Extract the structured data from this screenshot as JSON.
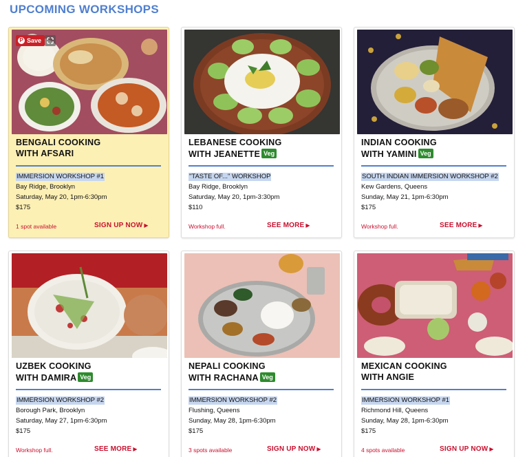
{
  "page": {
    "title": "UPCOMING WORKSHOPS"
  },
  "pin": {
    "save_label": "Save",
    "p_glyph": "P"
  },
  "cards": [
    {
      "name_line1": "BENGALI COOKING",
      "name_line2": "WITH AFSARI",
      "veg": "",
      "workshop_type": "IMMERSION WORKSHOP #1",
      "location": "Bay Ridge, Brooklyn",
      "date": "Saturday, May 20, 1pm-6:30pm",
      "price": "$175",
      "availability": "1 spot available",
      "action": "SIGN UP NOW"
    },
    {
      "name_line1": "LEBANESE COOKING",
      "name_line2": "WITH JEANETTE",
      "veg": "Veg",
      "workshop_type": "\"TASTE OF...\" WORKSHOP",
      "location": "Bay Ridge, Brooklyn",
      "date": "Saturday, May 20, 1pm-3:30pm",
      "price": "$110",
      "availability": "Workshop full.",
      "action": "SEE MORE"
    },
    {
      "name_line1": "INDIAN COOKING",
      "name_line2": "WITH YAMINI",
      "veg": "Veg",
      "workshop_type": "SOUTH INDIAN IMMERSION WORKSHOP #2",
      "location": "Kew Gardens, Queens",
      "date": "Sunday, May 21, 1pm-6:30pm",
      "price": "$175",
      "availability": "Workshop full.",
      "action": "SEE MORE"
    },
    {
      "name_line1": "UZBEK COOKING",
      "name_line2": "WITH DAMIRA",
      "veg": "Veg",
      "workshop_type": "IMMERSION WORKSHOP #2",
      "location": "Borough Park, Brooklyn",
      "date": "Saturday, May 27, 1pm-6:30pm",
      "price": "$175",
      "availability": "Workshop full.",
      "action": "SEE MORE"
    },
    {
      "name_line1": "NEPALI COOKING",
      "name_line2": "WITH RACHANA",
      "veg": "Veg",
      "workshop_type": "IMMERSION WORKSHOP #2",
      "location": "Flushing, Queens",
      "date": "Sunday, May 28, 1pm-6:30pm",
      "price": "$175",
      "availability": "3 spots available",
      "action": "SIGN UP NOW"
    },
    {
      "name_line1": "MEXICAN COOKING",
      "name_line2": "WITH ANGIE",
      "veg": "",
      "workshop_type": "IMMERSION WORKSHOP #1",
      "location": "Richmond Hill, Queens",
      "date": "Sunday, May 28, 1pm-6:30pm",
      "price": "$175",
      "availability": "4 spots available",
      "action": "SIGN UP NOW"
    }
  ],
  "icons": {
    "arrow": "right-triangle-icon"
  },
  "colors": {
    "title": "#4f7fcf",
    "accent_red": "#c8102e",
    "veg_green": "#2e8b2e",
    "highlight": "#fdf0b5"
  }
}
